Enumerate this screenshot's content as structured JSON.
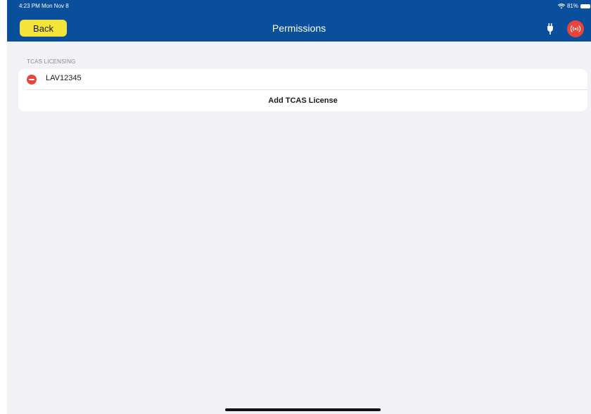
{
  "status_bar": {
    "time": "4:23 PM  Mon Nov 8",
    "battery": "81%"
  },
  "nav": {
    "back_label": "Back",
    "title": "Permissions",
    "icons": [
      "plug-icon",
      "broadcast-icon"
    ]
  },
  "section": {
    "label": "TCAS LICENSING",
    "licenses": [
      "LAV12345"
    ],
    "add_label": "Add TCAS License"
  },
  "colors": {
    "header": "#0a4f9b",
    "back_button": "#f4e338",
    "destructive": "#e8463d",
    "background": "#f2f1f6"
  }
}
